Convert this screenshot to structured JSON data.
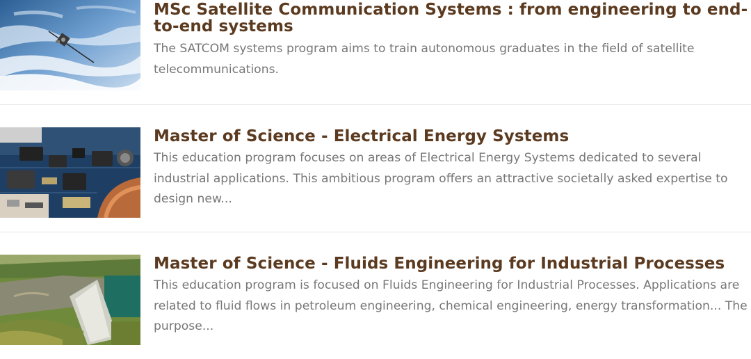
{
  "programs": [
    {
      "title": "MSc Satellite Communication Systems : from engineering to end-to-end systems",
      "description": "The SATCOM systems program aims to train autonomous graduates in the field of satellite telecommunications.",
      "image": "satellite-in-orbit-photo"
    },
    {
      "title": "Master of Science - Electrical Energy Systems",
      "description": "This education program focuses on areas of Electrical Energy Systems dedicated to several industrial applications. This ambitious program offers an attractive societally asked expertise to design new...",
      "image": "circuit-board-photo"
    },
    {
      "title": "Master of Science - Fluids Engineering for Industrial Processes",
      "description": "This education program is focused on Fluids Engineering for Industrial Processes. Applications are related to fluid flows in petroleum engineering, chemical engineering, energy transformation... The purpose...",
      "image": "dam-spillway-photo"
    }
  ],
  "colors": {
    "title": "#5b3a1f",
    "description": "#777777",
    "divider": "#e6e6e6"
  }
}
